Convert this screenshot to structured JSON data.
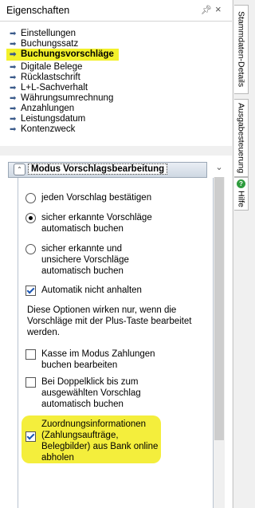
{
  "titlebar": {
    "title": "Eigenschaften",
    "pin_icon": "pin-icon",
    "close_icon": "close-icon"
  },
  "nav": {
    "items": [
      {
        "label": "Einstellungen",
        "active": false
      },
      {
        "label": "Buchungssatz",
        "active": false
      },
      {
        "label": "Buchungsvorschläge",
        "active": true
      },
      {
        "label": "Digitale Belege",
        "active": false
      },
      {
        "label": "Rücklastschrift",
        "active": false
      },
      {
        "label": "L+L-Sachverhalt",
        "active": false
      },
      {
        "label": "Währungsumrechnung",
        "active": false
      },
      {
        "label": "Anzahlungen",
        "active": false
      },
      {
        "label": "Leistungsdatum",
        "active": false
      },
      {
        "label": "Kontenzweck",
        "active": false
      }
    ]
  },
  "section": {
    "title": "Modus Vorschlagsbearbeitung",
    "radios": [
      {
        "label": "jeden Vorschlag bestätigen",
        "checked": false
      },
      {
        "label": "sicher erkannte Vorschläge automatisch buchen",
        "checked": true
      },
      {
        "label": "sicher erkannte und unsichere Vorschläge automatisch buchen",
        "checked": false
      }
    ],
    "automatik": {
      "label": "Automatik nicht anhalten",
      "checked": true
    },
    "note": "Diese Optionen wirken nur, wenn die Vorschläge mit der Plus-Taste bearbeitet werden.",
    "checks": [
      {
        "label": "Kasse im Modus Zahlungen buchen bearbeiten",
        "checked": false
      },
      {
        "label": "Bei Doppelklick bis zum ausgewählten Vorschlag automatisch buchen",
        "checked": false
      },
      {
        "label": "Zuordnungsinformationen (Zahlungsaufträge, Belegbilder) aus Bank online abholen",
        "checked": true
      }
    ]
  },
  "tabs": [
    {
      "label": "Stammdaten-Details"
    },
    {
      "label": "Ausgabesteuerung"
    },
    {
      "label": "Hilfe"
    }
  ],
  "colors": {
    "highlight": "#f3f12a",
    "accent": "#1a55b3",
    "help": "#2f9c3e"
  }
}
